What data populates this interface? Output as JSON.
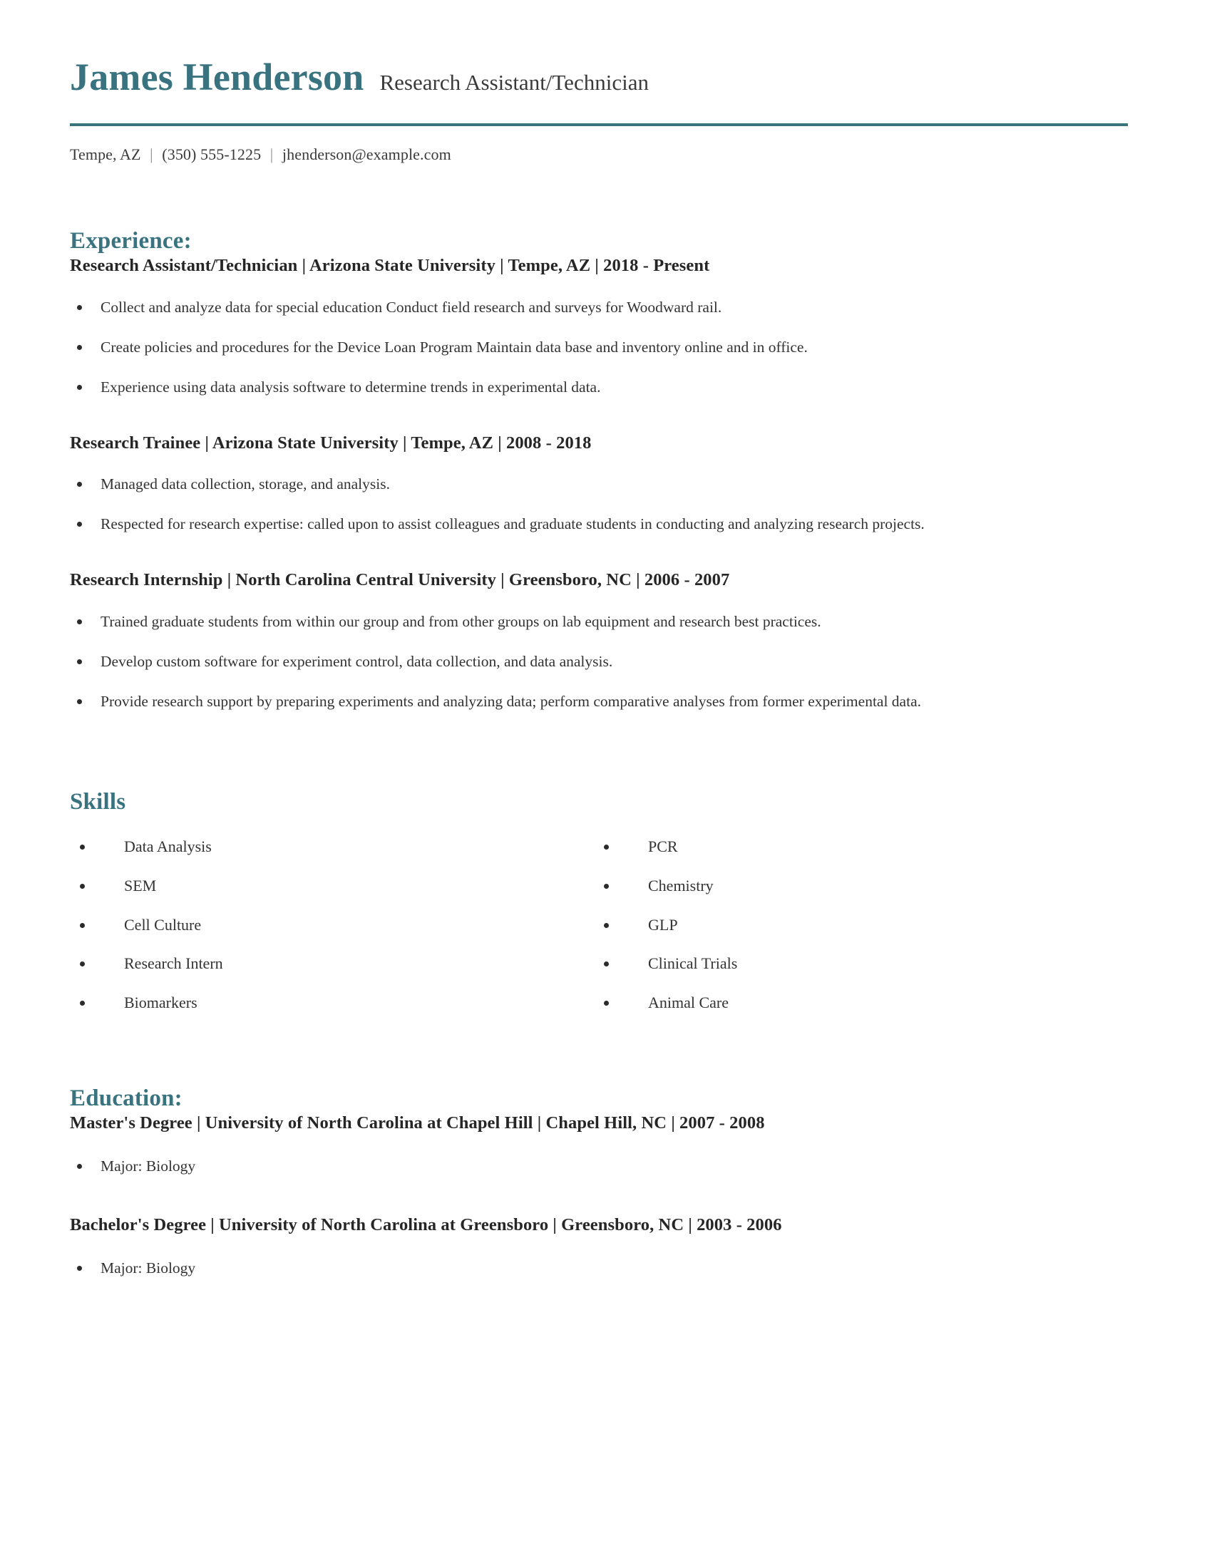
{
  "theme": {
    "accent": "#3a7380",
    "text": "#2b2b2b",
    "muted": "#3a3a3a"
  },
  "header": {
    "name": "James Henderson",
    "headline": "Research Assistant/Technician",
    "contact": {
      "location": "Tempe, AZ",
      "phone": "(350) 555-1225",
      "email": "jhenderson@example.com",
      "separator": "|"
    }
  },
  "experience": {
    "title": "Experience:",
    "entries": [
      {
        "heading": "Research Assistant/Technician | Arizona State University | Tempe, AZ | 2018 - Present",
        "role": "Research Assistant/Technician",
        "organization": "Arizona State University",
        "location": "Tempe, AZ",
        "dates": "2018 - Present",
        "bullets": [
          "Collect and analyze data for special education Conduct field research and surveys for Woodward rail.",
          "Create policies and procedures for the Device Loan Program Maintain data base and inventory online and in office.",
          "Experience using data analysis software to determine trends in experimental data."
        ]
      },
      {
        "heading": "Research Trainee | Arizona State University | Tempe, AZ | 2008 - 2018",
        "role": "Research Trainee",
        "organization": "Arizona State University",
        "location": "Tempe, AZ",
        "dates": "2008 - 2018",
        "bullets": [
          "Managed data collection, storage, and analysis.",
          "Respected for research expertise: called upon to assist colleagues and graduate students in conducting and analyzing research projects."
        ]
      },
      {
        "heading": "Research Internship | North Carolina Central University | Greensboro, NC | 2006 - 2007",
        "role": "Research Internship",
        "organization": "North Carolina Central University",
        "location": "Greensboro, NC",
        "dates": "2006 - 2007",
        "bullets": [
          "Trained graduate students from within our group and from other groups on lab equipment and research best practices.",
          "Develop custom software for experiment control, data collection, and data analysis.",
          "Provide research support by preparing experiments and analyzing data; perform comparative analyses from former experimental data."
        ]
      }
    ]
  },
  "skills": {
    "title": "Skills",
    "left_column": [
      "Data Analysis",
      "SEM",
      "Cell Culture",
      "Research Intern",
      "Biomarkers"
    ],
    "right_column": [
      "PCR",
      "Chemistry",
      "GLP",
      "Clinical Trials",
      "Animal Care"
    ]
  },
  "education": {
    "title": "Education:",
    "entries": [
      {
        "heading": "Master's Degree | University of North Carolina at Chapel Hill | Chapel Hill, NC | 2007 - 2008",
        "degree": "Master's Degree",
        "institution": "University of North Carolina at Chapel Hill",
        "location": "Chapel Hill, NC",
        "dates": "2007 - 2008",
        "bullets": [
          "Major: Biology"
        ]
      },
      {
        "heading": "Bachelor's Degree | University of North Carolina at Greensboro | Greensboro, NC | 2003 - 2006",
        "degree": "Bachelor's Degree",
        "institution": "University of North Carolina at Greensboro",
        "location": "Greensboro, NC",
        "dates": "2003 - 2006",
        "bullets": [
          "Major: Biology"
        ]
      }
    ]
  }
}
